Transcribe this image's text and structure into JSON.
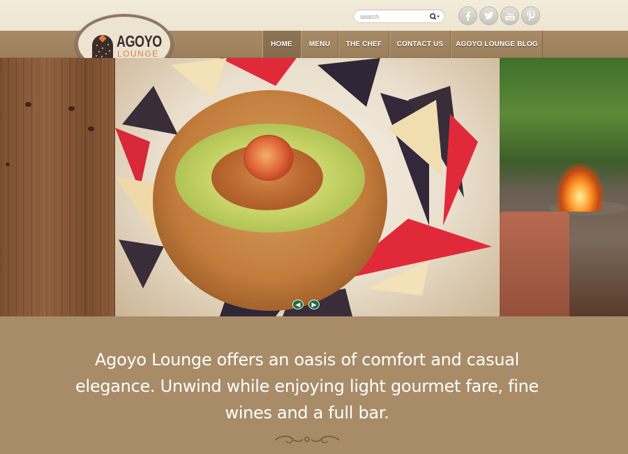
{
  "search": {
    "placeholder": "search"
  },
  "social": [
    {
      "name": "facebook-icon",
      "glyph": "f"
    },
    {
      "name": "twitter-icon",
      "glyph": "t"
    },
    {
      "name": "youtube-icon",
      "glyph": "You Tube"
    },
    {
      "name": "pinterest-icon",
      "glyph": "P"
    }
  ],
  "logo": {
    "name": "AGOYO",
    "sub": "LOUNGE"
  },
  "nav": {
    "home": "HOME",
    "menu": "MENU",
    "chef": "THE CHEF",
    "contact": "CONTACT US",
    "blog": "AGOYO LOUNGE BLOG",
    "active": "HOME"
  },
  "slider": {
    "prev": "◀",
    "next": "▶"
  },
  "description": "Agoyo Lounge offers an oasis of comfort and casual elegance. Unwind while enjoying light gourmet fare, fine wines and a full bar.",
  "colors": {
    "page_bg": "#a88c68",
    "nav_bg": "#a08560",
    "header_bg": "#f1e9d7",
    "slider_arrow": "#1f6b45",
    "logo_accent": "#e07a3c"
  }
}
